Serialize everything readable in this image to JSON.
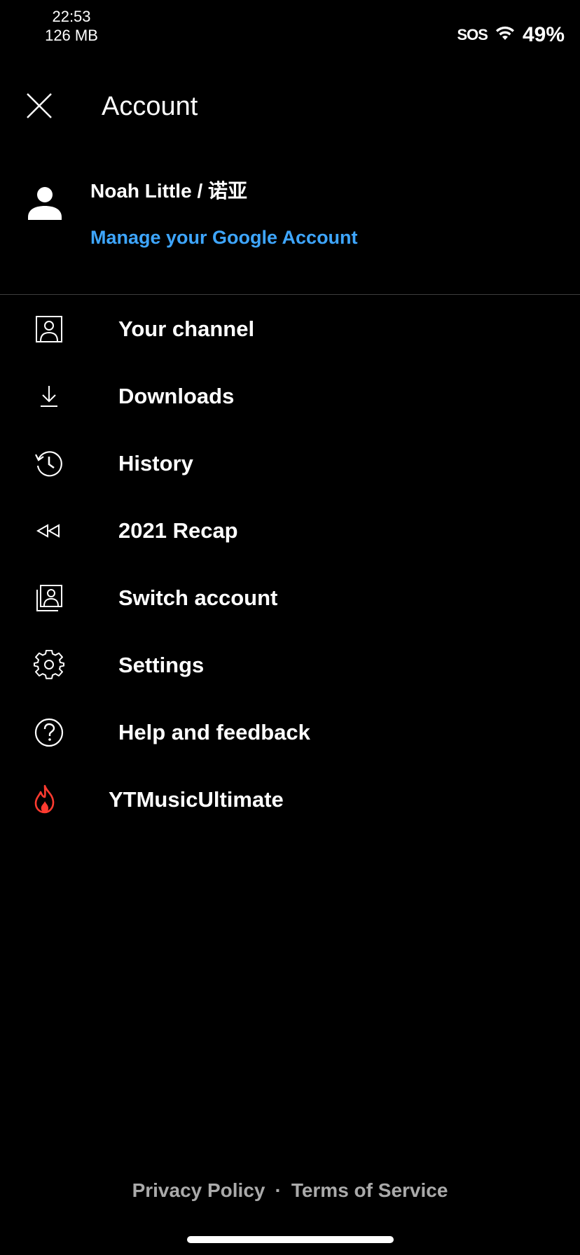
{
  "status_bar": {
    "time": "22:53",
    "memory": "126 MB",
    "carrier": "SOS",
    "battery": "49%"
  },
  "header": {
    "title": "Account"
  },
  "account": {
    "name": "Noah Little / 诺亚",
    "manage_link": "Manage your Google Account",
    "link_color": "#3ea6ff"
  },
  "menu": {
    "items": [
      {
        "label": "Your channel",
        "icon": "person-box-icon"
      },
      {
        "label": "Downloads",
        "icon": "download-icon"
      },
      {
        "label": "History",
        "icon": "history-icon"
      },
      {
        "label": "2021 Recap",
        "icon": "rewind-icon"
      },
      {
        "label": "Switch account",
        "icon": "switch-account-icon"
      },
      {
        "label": "Settings",
        "icon": "gear-icon"
      },
      {
        "label": "Help and feedback",
        "icon": "help-icon"
      },
      {
        "label": "YTMusicUltimate",
        "icon": "flame-icon"
      }
    ]
  },
  "footer": {
    "privacy": "Privacy Policy",
    "separator": "·",
    "terms": "Terms of Service"
  },
  "colors": {
    "background": "#000000",
    "accent_red": "#ff3b30"
  }
}
